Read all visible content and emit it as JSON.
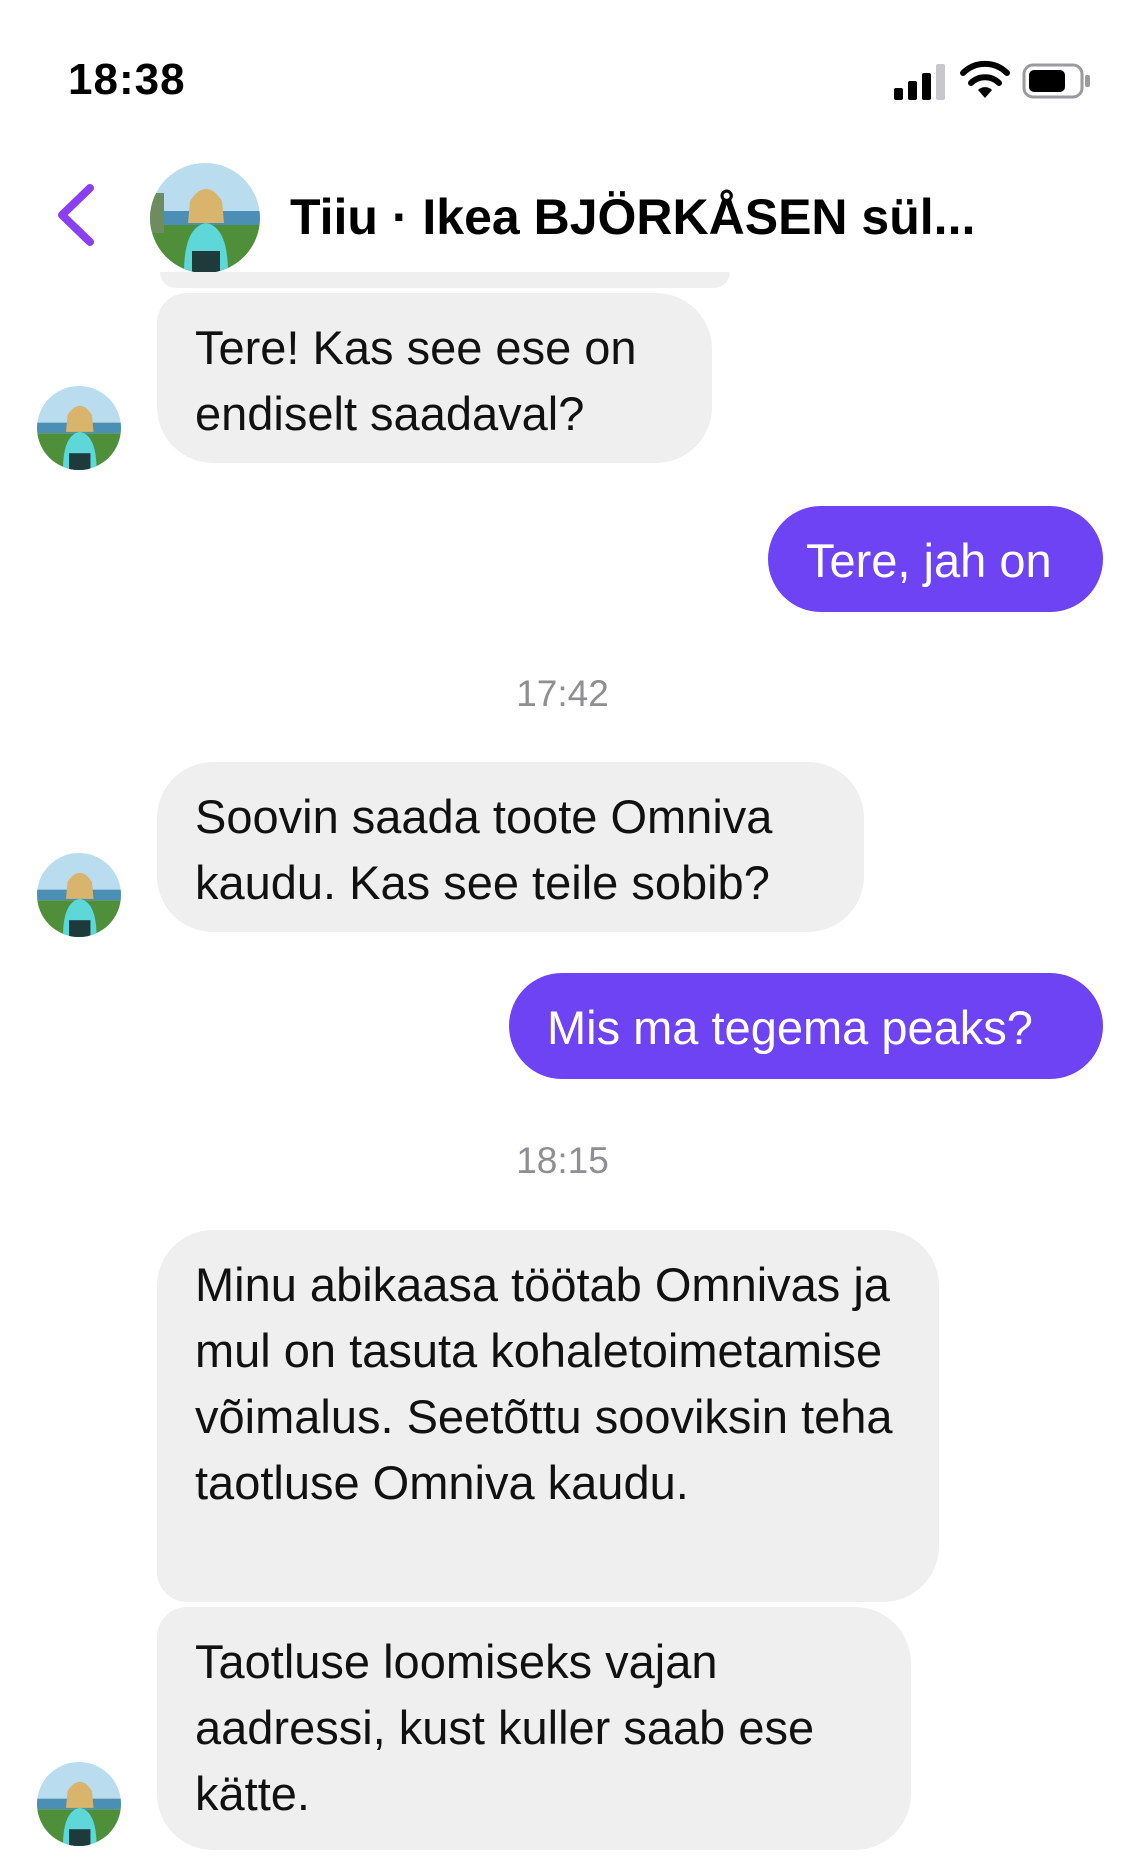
{
  "status_bar": {
    "time": "18:38",
    "icons": [
      "signal-icon",
      "wifi-icon",
      "battery-icon"
    ]
  },
  "header": {
    "back_icon": "chevron-left-icon",
    "title": "Tiiu · Ikea BJÖRKÅSEN sül..."
  },
  "colors": {
    "accent": "#8a3ff0",
    "outgoing_bubble": "#6d43f4",
    "incoming_bubble": "#efeff0",
    "timestamp": "#8e8e93"
  },
  "messages": [
    {
      "direction": "in",
      "text": "Tere! Kas see ese on endiselt saadaval?"
    },
    {
      "direction": "out",
      "text": "Tere, jah on"
    },
    {
      "type": "timestamp",
      "text": "17:42"
    },
    {
      "direction": "in",
      "text": "Soovin saada toote Omniva kaudu. Kas see teile sobib?"
    },
    {
      "direction": "out",
      "text": "Mis ma tegema peaks?"
    },
    {
      "type": "timestamp",
      "text": "18:15"
    },
    {
      "direction": "in",
      "text": "Minu abikaasa töötab Omnivas ja mul on tasuta kohaletoimetamise võimalus. Seetõttu sooviksin teha taotluse Omniva kaudu."
    },
    {
      "direction": "in",
      "text": "Taotluse loomiseks vajan aadressi, kust kuller saab ese kätte."
    }
  ]
}
